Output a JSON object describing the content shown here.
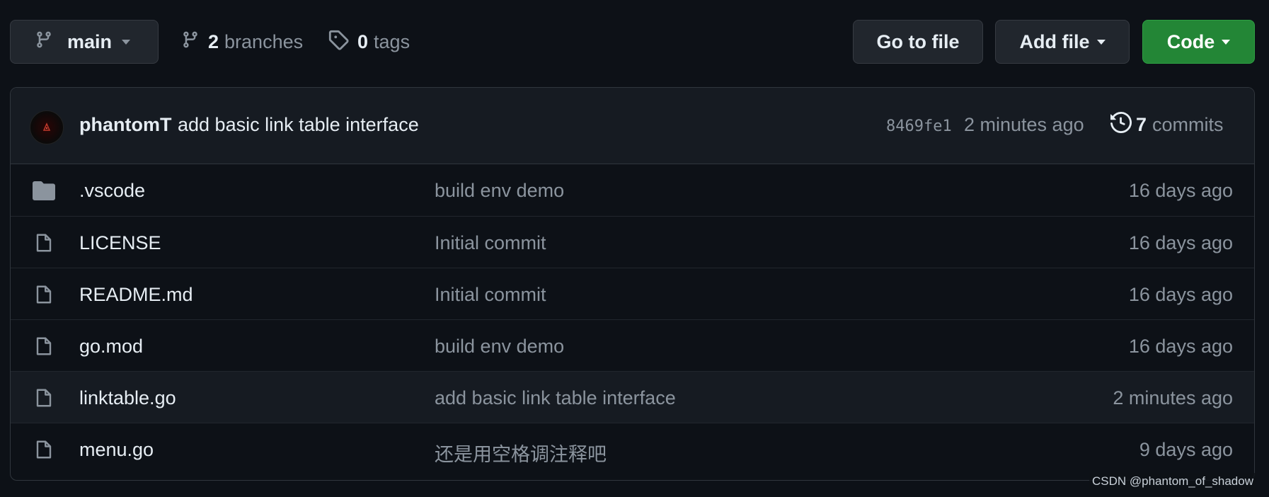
{
  "toolbar": {
    "branch_label": "main",
    "branches_count": "2",
    "branches_label": "branches",
    "tags_count": "0",
    "tags_label": "tags",
    "go_to_file_label": "Go to file",
    "add_file_label": "Add file",
    "code_label": "Code"
  },
  "latest_commit": {
    "author": "phantomT",
    "message": "add basic link table interface",
    "sha": "8469fe1",
    "time": "2 minutes ago",
    "commits_count": "7",
    "commits_label": "commits"
  },
  "files": [
    {
      "name": ".vscode",
      "type": "folder",
      "message": "build env demo",
      "age": "16 days ago"
    },
    {
      "name": "LICENSE",
      "type": "file",
      "message": "Initial commit",
      "age": "16 days ago"
    },
    {
      "name": "README.md",
      "type": "file",
      "message": "Initial commit",
      "age": "16 days ago"
    },
    {
      "name": "go.mod",
      "type": "file",
      "message": "build env demo",
      "age": "16 days ago"
    },
    {
      "name": "linktable.go",
      "type": "file",
      "message": "add basic link table interface",
      "age": "2 minutes ago"
    },
    {
      "name": "menu.go",
      "type": "file",
      "message": "还是用空格调注释吧",
      "age": "9 days ago"
    }
  ],
  "watermark": "CSDN @phantom_of_shadow",
  "colors": {
    "background": "#0d1117",
    "button": "#21262d",
    "code_button": "#238636",
    "muted_text": "#8b949e"
  },
  "icons": {
    "branch": "git-branch-icon",
    "tag": "tag-icon",
    "history": "history-icon",
    "folder": "folder-icon",
    "file": "file-icon"
  }
}
